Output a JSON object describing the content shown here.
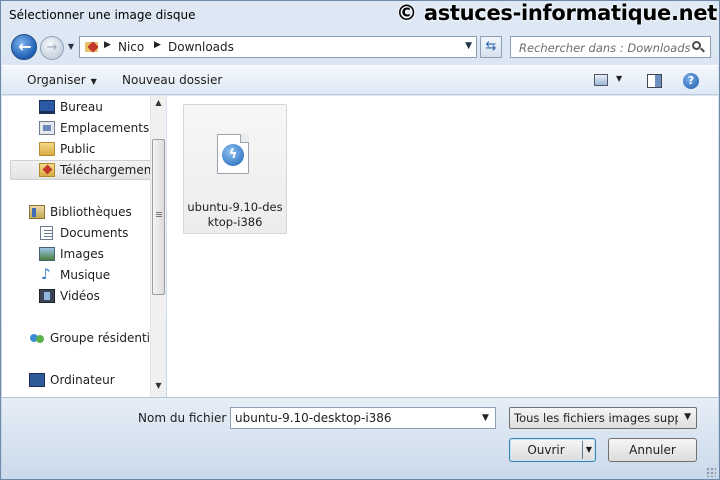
{
  "window": {
    "title": "Sélectionner une image disque"
  },
  "watermark": "© astuces-informatique.net",
  "nav": {
    "breadcrumb": [
      "Nico",
      "Downloads"
    ],
    "search_placeholder": "Rechercher dans : Downloads"
  },
  "toolbar": {
    "organize_label": "Organiser",
    "new_folder_label": "Nouveau dossier"
  },
  "sidebar": {
    "items": [
      {
        "label": "Bureau",
        "icon": "desktop-icon"
      },
      {
        "label": "Emplacements récents",
        "icon": "recent-places-icon"
      },
      {
        "label": "Public",
        "icon": "folder-icon"
      },
      {
        "label": "Téléchargements",
        "icon": "downloads-folder-icon",
        "selected": true
      },
      {
        "label": "Bibliothèques",
        "icon": "libraries-icon"
      },
      {
        "label": "Documents",
        "icon": "documents-icon"
      },
      {
        "label": "Images",
        "icon": "images-icon"
      },
      {
        "label": "Musique",
        "icon": "music-icon"
      },
      {
        "label": "Vidéos",
        "icon": "videos-icon"
      },
      {
        "label": "Groupe résidentiel",
        "icon": "homegroup-icon"
      },
      {
        "label": "Ordinateur",
        "icon": "computer-icon"
      }
    ]
  },
  "files": [
    {
      "name": "ubuntu-9.10-desktop-i386",
      "icon": "disc-image-file-icon"
    }
  ],
  "bottom": {
    "filename_label": "Nom du fichier :",
    "filename_value": "ubuntu-9.10-desktop-i386",
    "filetype_value": "Tous les fichiers images supportés",
    "open_label": "Ouvrir",
    "cancel_label": "Annuler"
  }
}
